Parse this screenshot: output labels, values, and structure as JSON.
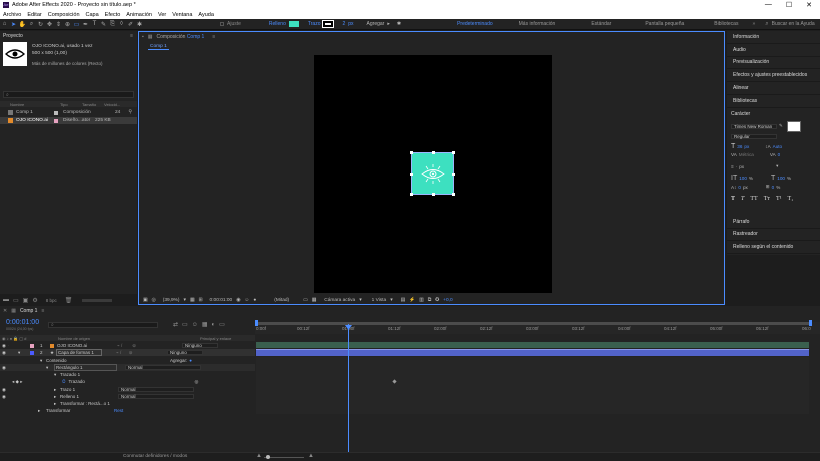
{
  "window": {
    "title": "Adobe After Effects 2020 - Proyecto sin título.aep *",
    "min": "—",
    "max": "☐",
    "close": "✕"
  },
  "menu": [
    "Archivo",
    "Editar",
    "Composición",
    "Capa",
    "Efecto",
    "Animación",
    "Ver",
    "Ventana",
    "Ayuda"
  ],
  "toolbar": {
    "ajuste_label": "Ajuste",
    "relleno_label": "Relleno",
    "relleno_color": "#3de0c0",
    "trazo_label": "Trazo",
    "trazo_value": "2",
    "trazo_unit": "px",
    "agregar_label": "Agregar",
    "workspaces": [
      "Predeterminado",
      "Más información",
      "Estándar",
      "Pantalla pequeña",
      "Bibliotecas"
    ],
    "active_workspace": "Predeterminado",
    "search_placeholder": "Buscar en la Ayuda"
  },
  "project": {
    "tab": "Proyecto",
    "asset_name": "OJO ICONO.ai",
    "asset_usage": ", usado 1 vez",
    "asset_dims": "500 x 500 (1,00)",
    "asset_colors": "Más de millones de colores (Recto)",
    "search_placeholder": "",
    "columns": [
      "Nombre",
      "Tipo",
      "Tamaño",
      "Velocid..."
    ],
    "items": [
      {
        "name": "Comp 1",
        "type": "Composición",
        "size": "",
        "speed": "24"
      },
      {
        "name": "OJO ICONO.ai",
        "type": "Diseño...ator",
        "size": "225 KB",
        "speed": ""
      }
    ],
    "bpc": "8 bpc"
  },
  "composition": {
    "tab": "Composición",
    "comp_name": "Comp 1",
    "breadcrumb": "Comp 1",
    "zoom": "(39,9%)",
    "timecode": "0:00:01:00",
    "resolution": "(Mitad)",
    "camera": "Cámara activa",
    "views": "1 Vista",
    "exposure": "+0,0",
    "icon_color": "#3de0c0"
  },
  "right_panels": [
    "Información",
    "Audio",
    "Previsualización",
    "Efectos y ajustes preestablecidos",
    "Alinear",
    "Bibliotecas"
  ],
  "character": {
    "title": "Carácter",
    "font": "Times New Roman",
    "style": "Regular",
    "size": "36",
    "size_unit": "px",
    "leading": "Auto",
    "kerning": "Métrica",
    "tracking": "0",
    "stroke_unit": "px",
    "vscale": "100",
    "hscale": "100",
    "baseline": "0",
    "baseline_unit": "px",
    "tsume": "0",
    "tsume_unit": "%",
    "pct": "%",
    "formats": [
      "T",
      "T",
      "TT",
      "Tт",
      "T¹",
      "T₁"
    ]
  },
  "bottom_panels": [
    "Párrafo",
    "Rastreador",
    "Relleno según el contenido"
  ],
  "timeline": {
    "tab": "Comp 1",
    "timecode": "0:00:01:00",
    "fps": "00024 (24,00 fps)",
    "search_placeholder": "",
    "col_name": "Nombre de origen",
    "col_parent": "Principal y enlace",
    "layers": [
      {
        "num": "1",
        "name": "OJO ICONO.ai",
        "parent": "Ninguno"
      },
      {
        "num": "2",
        "name": "Capa de formas 1",
        "parent": "Ninguno"
      }
    ],
    "props": {
      "contenido": "Contenido",
      "agregar": "Agregar:",
      "rect": "Rectángulo 1",
      "rect_mode": "Normal",
      "trazado_group": "Trazado 1",
      "trazado": "Trazado",
      "trazo": "Trazo 1",
      "trazo_mode": "Normal",
      "relleno": "Relleno 1",
      "relleno_mode": "Normal",
      "transform_rect": "Transformar : Rectá...o 1",
      "transformar": "Transformar",
      "restablecer": "Rest"
    },
    "ruler": [
      "0:00f",
      "00:12f",
      "01:00f",
      "01:12f",
      "02:00f",
      "02:12f",
      "03:00f",
      "03:12f",
      "04:00f",
      "04:12f",
      "05:00f",
      "05:12f",
      "06:0"
    ],
    "footer": "Conmutar definidores / modos"
  }
}
